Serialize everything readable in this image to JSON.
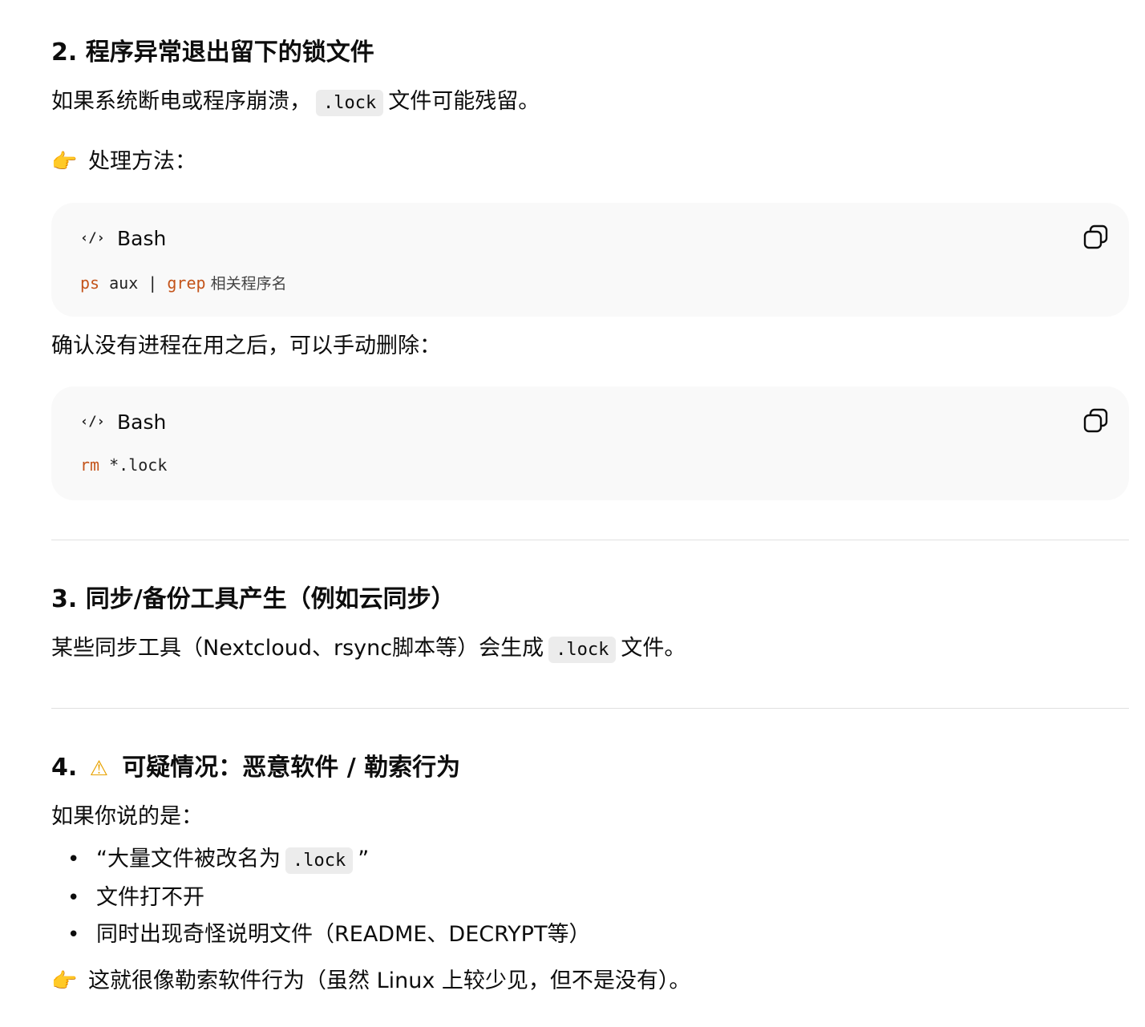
{
  "section2": {
    "title": "2. 程序异常退出留下的锁文件",
    "intro_before": "如果系统断电或程序崩溃，",
    "intro_code": ".lock",
    "intro_after": "文件可能残留。",
    "handle_emoji": "👉",
    "handle_label": "处理方法：",
    "code1": {
      "lang": "Bash",
      "cmd1": "ps",
      "arg1": " aux | ",
      "cmd2": "grep",
      "arg2": " 相关程序名"
    },
    "confirm_text": "确认没有进程在用之后，可以手动删除：",
    "code2": {
      "lang": "Bash",
      "cmd1": "rm",
      "arg1": " *.lock"
    }
  },
  "section3": {
    "title": "3. 同步/备份工具产生（例如云同步）",
    "text_before": "某些同步工具（Nextcloud、rsync脚本等）会生成",
    "text_code": ".lock",
    "text_after": "文件。"
  },
  "section4": {
    "title_num": "4.",
    "title_icon": "⚠",
    "title_text": "可疑情况：恶意软件 / 勒索行为",
    "intro": "如果你说的是：",
    "bullets": {
      "b1_before": "“大量文件被改名为",
      "b1_code": ".lock",
      "b1_after": "”",
      "b2": "文件打不开",
      "b3": "同时出现奇怪说明文件（README、DECRYPT等）"
    },
    "conclusion_emoji": "👉",
    "conclusion": "这就很像勒索软件行为（虽然 Linux 上较少见，但不是没有）。"
  },
  "icons": {
    "code": "code-icon",
    "copy": "copy-icon",
    "warning": "warning-icon",
    "pointing": "pointing-hand-icon"
  }
}
